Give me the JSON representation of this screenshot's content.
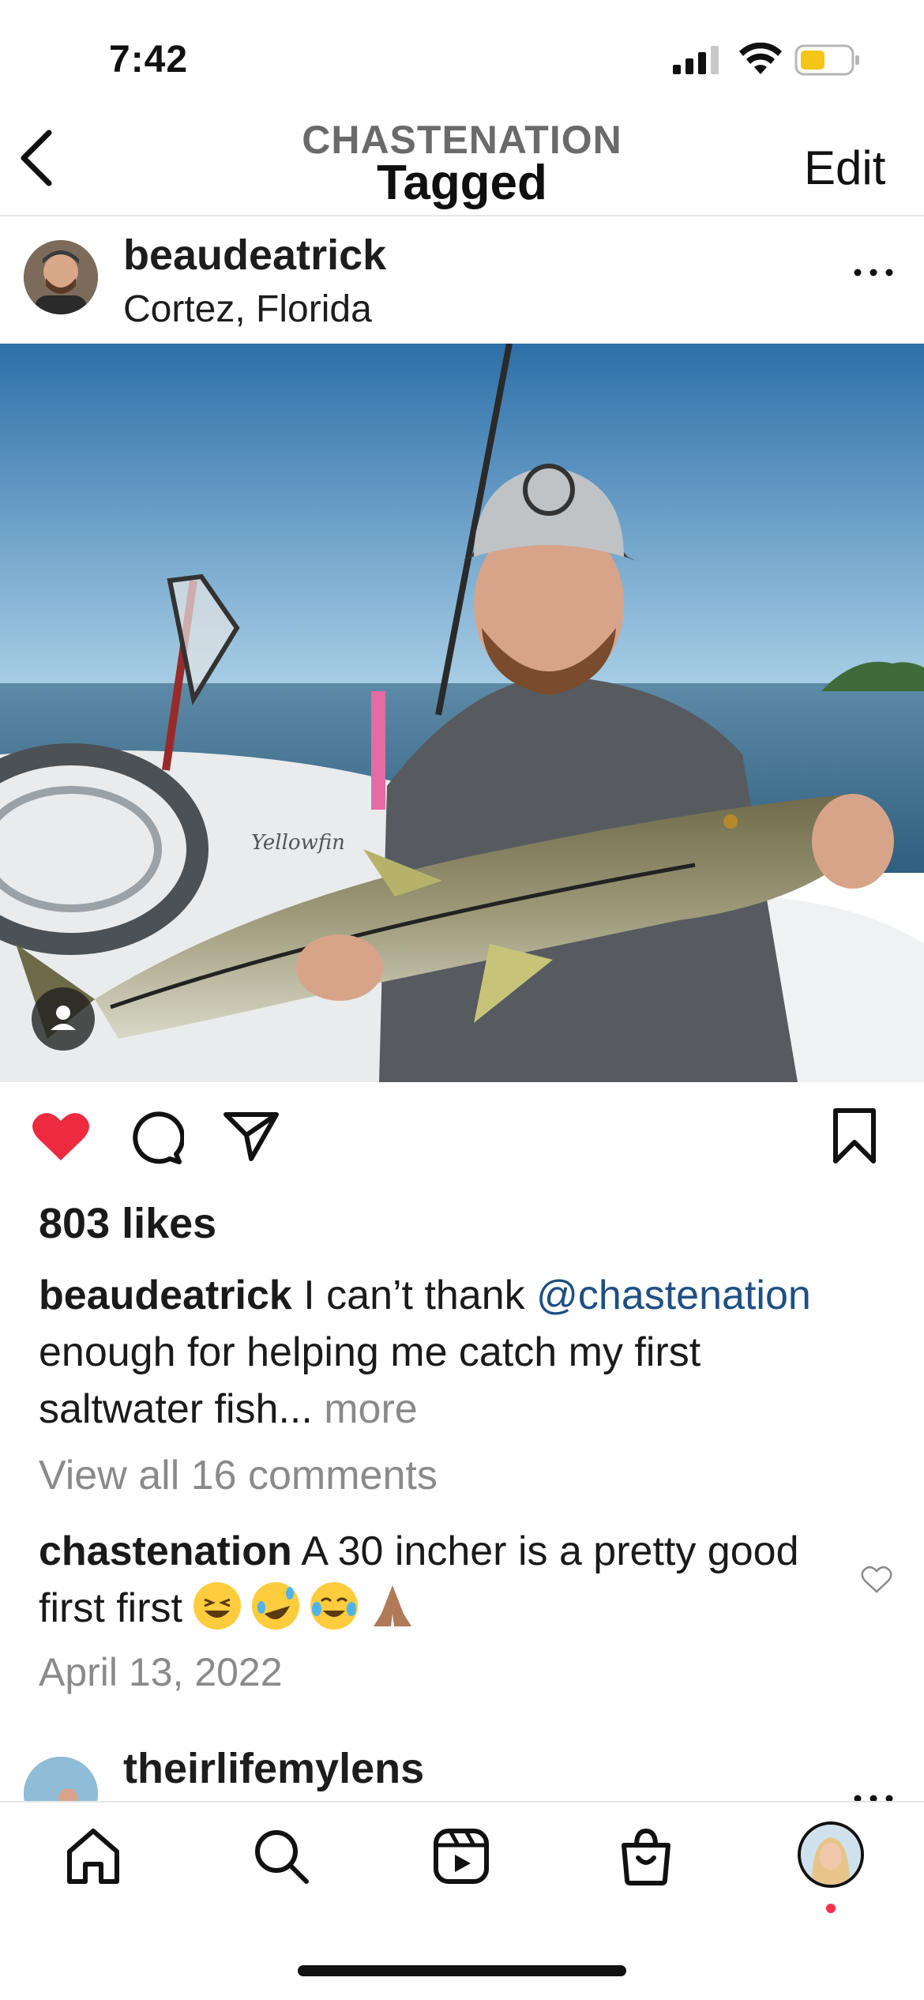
{
  "status_bar": {
    "time": "7:42",
    "battery_color": "#f5c518"
  },
  "header": {
    "subtitle": "CHASTENATION",
    "title": "Tagged",
    "edit_label": "Edit"
  },
  "post": {
    "username": "beaudeatrick",
    "location": "Cortez, Florida",
    "likes": "803 likes",
    "caption": {
      "username": "beaudeatrick",
      "text_1": " I can’t thank ",
      "mention": "@chastenation",
      "text_2": " enough for helping me catch my first saltwater fish...",
      "more": " more"
    },
    "view_all_comments": "View all 16 comments",
    "top_comment": {
      "username": "chastenation",
      "text": " A 30 incher is a pretty good first first "
    },
    "date": "April 13, 2022",
    "like_color": "#ed2a3f"
  },
  "next_post": {
    "username": "theirlifemylens"
  },
  "tabbar": {
    "items": [
      "home-icon",
      "search-icon",
      "reels-icon",
      "shop-icon",
      "profile-avatar"
    ]
  }
}
